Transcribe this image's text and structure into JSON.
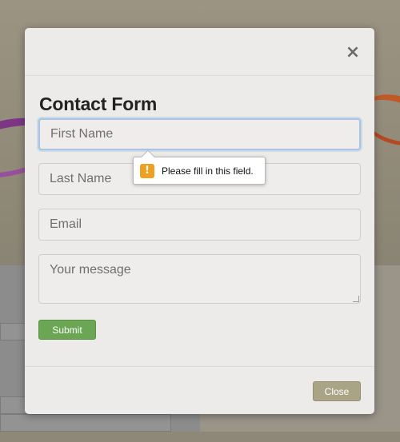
{
  "modal": {
    "close_icon": "×",
    "title": "Contact Form",
    "fields": {
      "first_name": {
        "placeholder": "First Name",
        "value": ""
      },
      "last_name": {
        "placeholder": "Last Name",
        "value": ""
      },
      "email": {
        "placeholder": "Email",
        "value": ""
      },
      "message": {
        "placeholder": "Your message",
        "value": ""
      }
    },
    "submit_label": "Submit",
    "close_label": "Close"
  },
  "validation_tooltip": {
    "icon": "warning-icon",
    "icon_glyph": "!",
    "message": "Please fill in this field."
  },
  "colors": {
    "submit_button": "#6aa653",
    "close_button": "#a9a486",
    "focus_ring": "#a9c4e2",
    "warning": "#f0a020"
  }
}
